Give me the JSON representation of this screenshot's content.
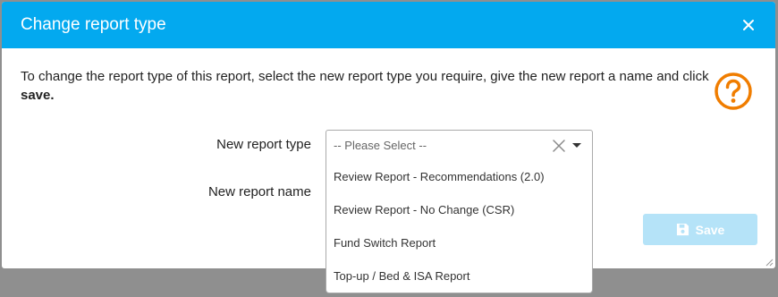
{
  "dialog": {
    "title": "Change report type",
    "close_icon": "close-icon",
    "instructions_text": "To change the report type of this report, select the new report type you require, give the new report a name and click ",
    "instructions_bold": "save.",
    "help_icon": "question-circle-icon",
    "help_color": "#f07d00",
    "header_color": "#03a9ef"
  },
  "form": {
    "report_type_label": "New report type",
    "report_type_placeholder": "-- Please Select --",
    "report_name_label": "New report name"
  },
  "dropdown": {
    "options": [
      "Review Report - Recommendations (2.0)",
      "Review Report - No Change (CSR)",
      "Fund Switch Report",
      "Top-up / Bed & ISA Report"
    ]
  },
  "save_button": {
    "label": "Save",
    "icon": "floppy-disk-icon",
    "disabled": true
  }
}
